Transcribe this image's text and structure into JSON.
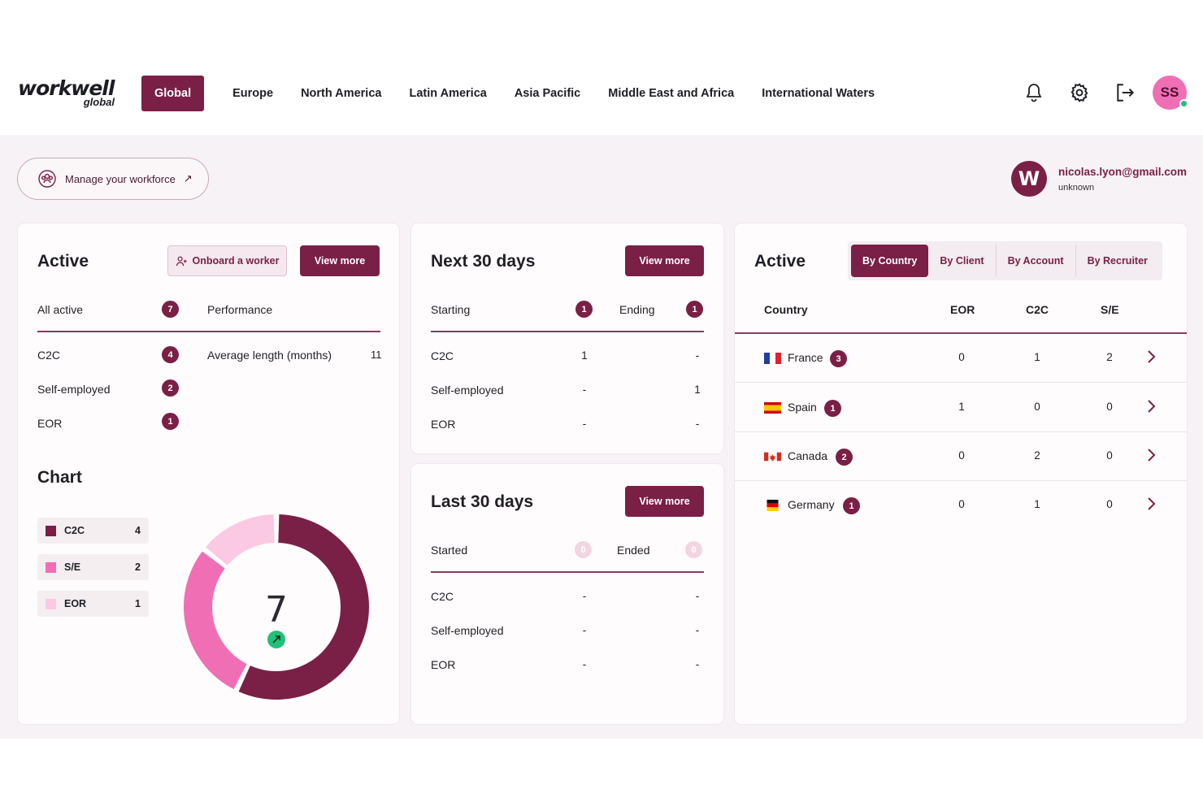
{
  "header": {
    "logo_main": "workwell",
    "logo_sub": "global",
    "nav": [
      "Global",
      "Europe",
      "North America",
      "Latin America",
      "Asia Pacific",
      "Middle East and Africa",
      "International Waters"
    ],
    "avatar_initials": "SS"
  },
  "topbar": {
    "manage_label": "Manage your workforce",
    "user_initial": "W",
    "user_email": "nicolas.lyon@gmail.com",
    "user_status": "unknown"
  },
  "active_card": {
    "title": "Active",
    "onboard_label": "Onboard a worker",
    "view_more": "View more",
    "all_active_label": "All active",
    "all_active_count": "7",
    "performance_label": "Performance",
    "rows": [
      {
        "label": "C2C",
        "count": "4"
      },
      {
        "label": "Self-employed",
        "count": "2"
      },
      {
        "label": "EOR",
        "count": "1"
      }
    ],
    "avg_label": "Average length (months)",
    "avg_value": "11",
    "chart_title": "Chart",
    "chart_total": "7"
  },
  "chart_data": {
    "type": "pie",
    "categories": [
      "C2C",
      "S/E",
      "EOR"
    ],
    "values": [
      4,
      2,
      1
    ],
    "colors": [
      "#7a1f46",
      "#f06fb4",
      "#fbc9e3"
    ],
    "total": 7
  },
  "next30": {
    "title": "Next 30 days",
    "view_more": "View more",
    "starting_label": "Starting",
    "starting_count": "1",
    "ending_label": "Ending",
    "ending_count": "1",
    "rows": [
      {
        "label": "C2C",
        "start": "1",
        "end": "-"
      },
      {
        "label": "Self-employed",
        "start": "-",
        "end": "1"
      },
      {
        "label": "EOR",
        "start": "-",
        "end": "-"
      }
    ]
  },
  "last30": {
    "title": "Last 30 days",
    "view_more": "View more",
    "started_label": "Started",
    "started_count": "0",
    "ended_label": "Ended",
    "ended_count": "0",
    "rows": [
      {
        "label": "C2C",
        "start": "-",
        "end": "-"
      },
      {
        "label": "Self-employed",
        "start": "-",
        "end": "-"
      },
      {
        "label": "EOR",
        "start": "-",
        "end": "-"
      }
    ]
  },
  "country_card": {
    "title": "Active",
    "tabs": [
      "By Country",
      "By Client",
      "By Account",
      "By Recruiter"
    ],
    "headers": {
      "country": "Country",
      "eor": "EOR",
      "c2c": "C2C",
      "se": "S/E"
    },
    "rows": [
      {
        "name": "France",
        "count": "3",
        "eor": "0",
        "c2c": "1",
        "se": "2",
        "flag": "france-flag-icon"
      },
      {
        "name": "Spain",
        "count": "1",
        "eor": "1",
        "c2c": "0",
        "se": "0",
        "flag": "spain-flag-icon"
      },
      {
        "name": "Canada",
        "count": "2",
        "eor": "0",
        "c2c": "2",
        "se": "0",
        "flag": "canada-flag-icon"
      },
      {
        "name": "Germany",
        "count": "1",
        "eor": "0",
        "c2c": "1",
        "se": "0",
        "flag": "germany-flag-icon"
      }
    ]
  },
  "colors": {
    "brand": "#7a1f46",
    "pink": "#f06fb4",
    "light_pink": "#fbc9e3",
    "online": "#22c07a"
  }
}
